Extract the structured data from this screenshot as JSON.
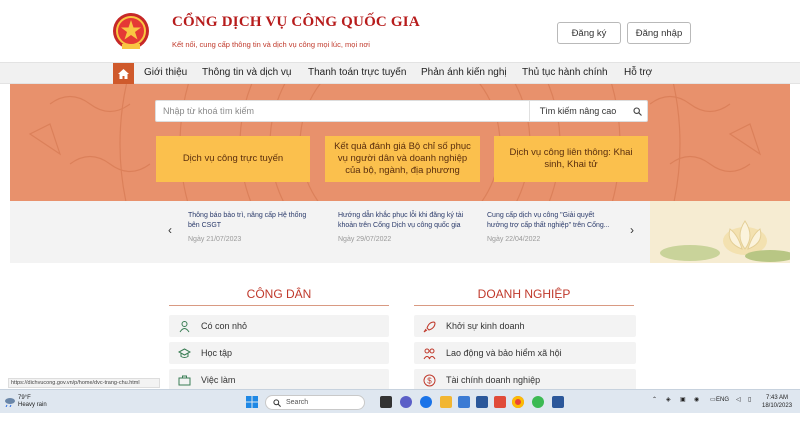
{
  "header": {
    "title": "CỔNG DỊCH VỤ CÔNG QUỐC GIA",
    "subtitle": "Kết nối, cung cấp thông tin và dịch vụ công mọi lúc, mọi nơi",
    "register_label": "Đăng ký",
    "login_label": "Đăng nhập"
  },
  "nav": {
    "items": [
      "Giới thiệu",
      "Thông tin và dịch vụ",
      "Thanh toán trực tuyến",
      "Phản ánh kiến nghị",
      "Thủ tục hành chính",
      "Hỗ trợ"
    ]
  },
  "search": {
    "placeholder": "Nhập từ khoá tìm kiếm",
    "advanced_label": "Tìm kiếm nâng cao"
  },
  "cards": [
    {
      "label": "Dịch vụ công trực tuyến"
    },
    {
      "label": "Kết quả đánh giá Bộ chỉ số phục vụ người dân và doanh nghiệp của bộ, ngành, địa phương"
    },
    {
      "label": "Dịch vụ công liên thông: Khai sinh, Khai tử"
    }
  ],
  "news": [
    {
      "title": "Thông báo bảo trì, nâng cấp Hệ thống bên CSGT",
      "date": "Ngày 21/07/2023"
    },
    {
      "title": "Hướng dẫn khắc phục lỗi khi đăng ký tài khoản trên Cổng Dịch vụ công quốc gia",
      "date": "Ngày 29/07/2022"
    },
    {
      "title": "Cung cấp dịch vụ công \"Giải quyết hưởng trợ cấp thất nghiệp\" trên Cổng...",
      "date": "Ngày 22/04/2022"
    }
  ],
  "citizen": {
    "title": "CÔNG DÂN",
    "items": [
      "Có con nhỏ",
      "Học tập",
      "Việc làm"
    ]
  },
  "business": {
    "title": "DOANH NGHIỆP",
    "items": [
      "Khởi sự kinh doanh",
      "Lao động và bảo hiểm xã hội",
      "Tài chính doanh nghiệp"
    ]
  },
  "status_url": "https://dichvucong.gov.vn/p/home/dvc-trang-chu.html",
  "taskbar": {
    "weather_temp": "79°F",
    "weather_desc": "Heavy rain",
    "search_label": "Search",
    "lang": "ENG",
    "time": "7:43 AM",
    "date": "18/10/2023"
  },
  "colors": {
    "brand_red": "#b71c1c",
    "hero_orange": "#e8916c",
    "card_yellow": "#fbc04d",
    "nav_home": "#cf5a2c"
  }
}
